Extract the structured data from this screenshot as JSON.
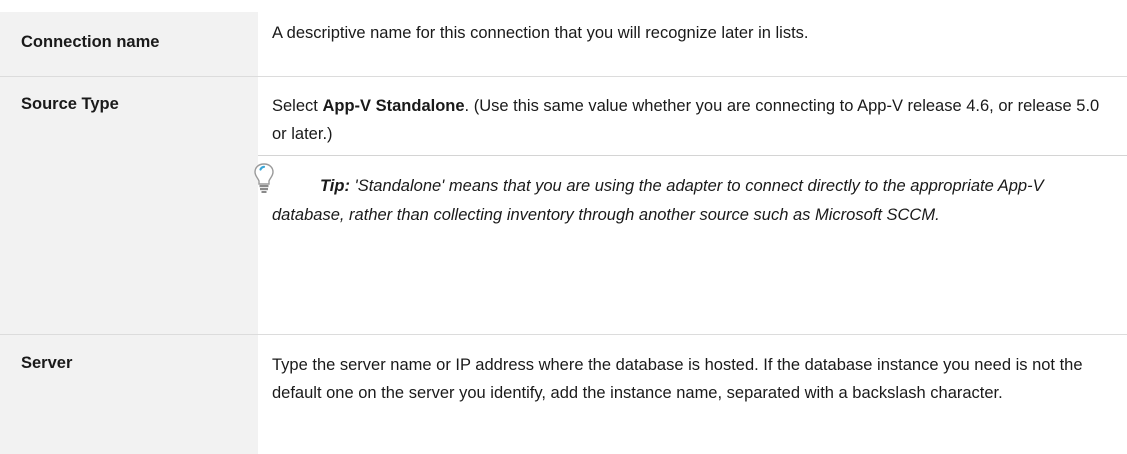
{
  "rows": [
    {
      "label": "Connection name",
      "description": "A descriptive name for this connection that you will recognize later in lists."
    },
    {
      "label": "Source Type",
      "description_prefix": "Select ",
      "description_bold": "App-V Standalone",
      "description_suffix": ". (Use this same value whether you are connecting to App-V release 4.6, or release 5.0 or later.)",
      "tip": {
        "icon": "lightbulb-icon",
        "label": "Tip:",
        "text": " 'Standalone' means that you are using the adapter to connect directly to the appropriate App-V database, rather than collecting inventory through another source such as Microsoft SCCM."
      }
    },
    {
      "label": "Server",
      "description": "Type the server name or IP address where the database is hosted. If the database instance you need is not the default one on the server you identify, add the instance name, separated with a backslash character."
    }
  ]
}
